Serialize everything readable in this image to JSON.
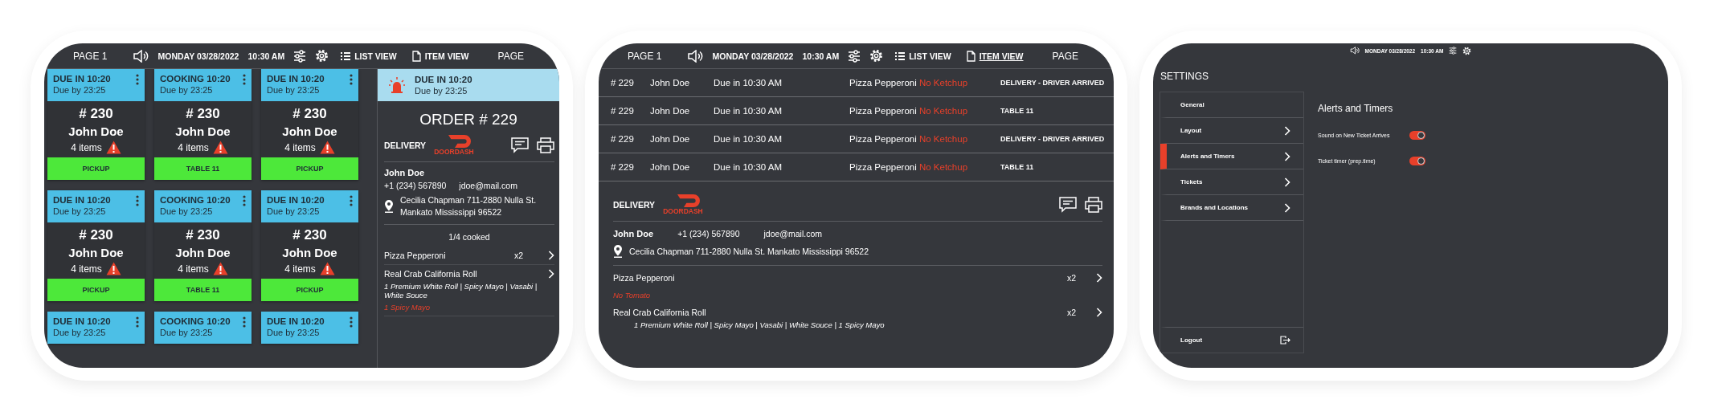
{
  "ticket_screen": {
    "top_bar": {
      "page_label": "PAGE 1",
      "date": "MONDAY 03/28/2022",
      "time": "10:30 AM",
      "views": [
        {
          "label": "LIST VIEW",
          "selected": false
        },
        {
          "label": "ITEM VIEW",
          "selected": false
        }
      ],
      "next_page": "PAGE"
    },
    "tickets": [
      {
        "kind": "full",
        "status": "DUE IN 10:20",
        "due_by": "Due by 23:25",
        "number": "# 230",
        "customer": "John Doe",
        "items": "4 items",
        "destination": "PICKUP"
      },
      {
        "kind": "full",
        "status": "COOKING 10:20",
        "due_by": "Due by 23:25",
        "number": "# 230",
        "customer": "John Doe",
        "items": "4 items",
        "destination": "TABLE 11"
      },
      {
        "kind": "full",
        "status": "DUE IN 10:20",
        "due_by": "Due by 23:25",
        "number": "# 230",
        "customer": "John Doe",
        "items": "4 items",
        "destination": "PICKUP"
      },
      {
        "kind": "full",
        "status": "DUE IN 10:20",
        "due_by": "Due by 23:25",
        "number": "# 230",
        "customer": "John Doe",
        "items": "4 items",
        "destination": "PICKUP"
      },
      {
        "kind": "full",
        "status": "COOKING 10:20",
        "due_by": "Due by 23:25",
        "number": "# 230",
        "customer": "John Doe",
        "items": "4 items",
        "destination": "TABLE 11"
      },
      {
        "kind": "full",
        "status": "DUE IN 10:20",
        "due_by": "Due by 23:25",
        "number": "# 230",
        "customer": "John Doe",
        "items": "4 items",
        "destination": "PICKUP"
      },
      {
        "kind": "header",
        "status": "DUE IN 10:20",
        "due_by": "Due by 23:25"
      },
      {
        "kind": "header",
        "status": "COOKING 10:20",
        "due_by": "Due by 23:25"
      },
      {
        "kind": "header",
        "status": "DUE IN 10:20",
        "due_by": "Due by 23:25"
      }
    ],
    "order_detail": {
      "status": "DUE IN 10:20",
      "due_by": "Due by 23:25",
      "title": "ORDER # 229",
      "order_type": "DELIVERY",
      "provider": "DOORDASH",
      "customer": "John Doe",
      "phone": "+1 (234) 567890",
      "email": "jdoe@mail.com",
      "address_lines": [
        "Cecilia Chapman 711-2880 Nulla St.",
        "Mankato Mississippi 96522"
      ],
      "progress": "1/4 cooked",
      "items": [
        {
          "name": "Pizza Pepperoni",
          "qty": "x2"
        },
        {
          "name": "Real Crab California Roll",
          "modifiers": [
            {
              "kind": "option",
              "text": "1 Premium White Roll | Spicy Mayo | Vasabi | White Souce"
            },
            {
              "kind": "warning",
              "text": "1 Spicy Mayo"
            }
          ]
        }
      ]
    }
  },
  "list_screen": {
    "top_bar": {
      "page_label": "PAGE 1",
      "date": "MONDAY 03/28/2022",
      "time": "10:30 AM",
      "views": [
        {
          "label": "LIST VIEW",
          "selected": false
        },
        {
          "label": "ITEM VIEW",
          "selected": true
        }
      ],
      "next_page": "PAGE"
    },
    "rows": [
      {
        "number": "# 229",
        "customer": "John Doe",
        "due": "Due in 10:30 AM",
        "item": "Pizza Pepperoni",
        "note": "No Ketchup",
        "destination": "DELIVERY - DRIVER ARRIVED"
      },
      {
        "number": "# 229",
        "customer": "John Doe",
        "due": "Due in 10:30 AM",
        "item": "Pizza Pepperoni",
        "note": "No Ketchup",
        "destination": "TABLE 11"
      },
      {
        "number": "# 229",
        "customer": "John Doe",
        "due": "Due in 10:30 AM",
        "item": "Pizza Pepperoni",
        "note": "No Ketchup",
        "destination": "DELIVERY - DRIVER ARRIVED"
      },
      {
        "number": "# 229",
        "customer": "John Doe",
        "due": "Due in 10:30 AM",
        "item": "Pizza Pepperoni",
        "note": "No Ketchup",
        "destination": "TABLE 11"
      }
    ],
    "order_detail": {
      "order_type": "DELIVERY",
      "provider": "DOORDASH",
      "customer": "John Doe",
      "phone": "+1 (234) 567890",
      "email": "jdoe@mail.com",
      "address_lines": [
        "Cecilia Chapman 711-2880 Nulla St. Mankato Mississippi 96522"
      ],
      "items": [
        {
          "name": "Pizza Pepperoni",
          "qty": "x2",
          "modifiers": [
            {
              "kind": "warning",
              "text": "No Tomato"
            }
          ]
        },
        {
          "name": "Real Crab California Roll",
          "qty": "x2",
          "modifiers": [
            {
              "kind": "option",
              "text": "1 Premium White Roll | Spicy Mayo | Vasabi | White Souce | 1 Spicy Mayo"
            }
          ]
        }
      ]
    }
  },
  "settings_screen": {
    "top_bar": {
      "date": "MONDAY 03/28/2022",
      "time": "10:30 AM"
    },
    "title": "SETTINGS",
    "menu": [
      {
        "label": "General",
        "selected": false,
        "has_submenu": false
      },
      {
        "label": "Layout",
        "selected": false,
        "has_submenu": true
      },
      {
        "label": "Alerts and Timers",
        "selected": true,
        "has_submenu": true
      },
      {
        "label": "Tickets",
        "selected": false,
        "has_submenu": true
      },
      {
        "label": "Brands and Locations",
        "selected": false,
        "has_submenu": true
      }
    ],
    "logout": "Logout",
    "section_title": "Alerts and Timers",
    "toggles": [
      {
        "label": "Sound on New Ticket Arrives",
        "on": true
      },
      {
        "label": "Ticket timer (prep.time)",
        "on": true
      }
    ]
  }
}
